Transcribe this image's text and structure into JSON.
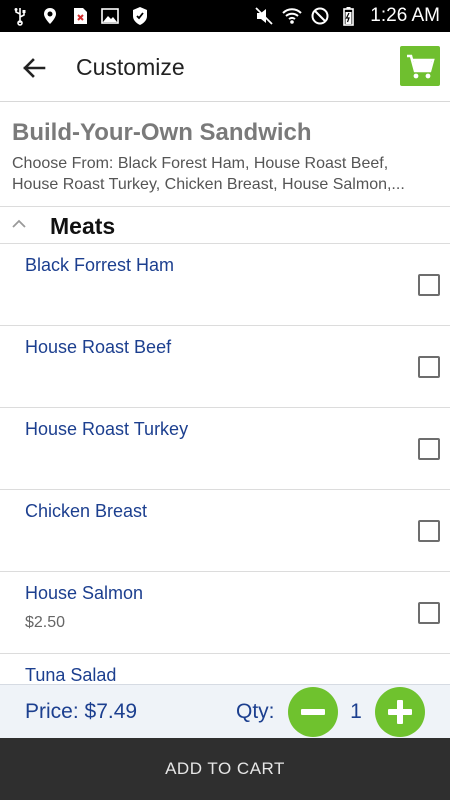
{
  "status_bar": {
    "time": "1:26 AM",
    "left_icons": [
      "usb-icon",
      "location-icon",
      "file-error-icon",
      "image-icon",
      "shield-icon"
    ],
    "right_icons": [
      "mute-icon",
      "wifi-icon",
      "block-icon",
      "battery-icon"
    ]
  },
  "app_bar": {
    "title": "Customize",
    "back_icon": "arrow-left-icon",
    "cart_icon": "cart-icon"
  },
  "item": {
    "title": "Build-Your-Own Sandwich",
    "description_line1": "Choose From: Black Forest Ham, House Roast Beef,",
    "description_line2": "House Roast Turkey, Chicken Breast, House Salmon,..."
  },
  "section": {
    "title": "Meats",
    "collapse_icon": "chevron-up-icon"
  },
  "options": [
    {
      "name": "Black Forrest Ham",
      "price": "",
      "checked": false
    },
    {
      "name": "House Roast Beef",
      "price": "",
      "checked": false
    },
    {
      "name": "House Roast Turkey",
      "price": "",
      "checked": false
    },
    {
      "name": "Chicken Breast",
      "price": "",
      "checked": false
    },
    {
      "name": "House Salmon",
      "price": "$2.50",
      "checked": false
    },
    {
      "name": "Tuna Salad",
      "price": "",
      "checked": false
    }
  ],
  "footer": {
    "price_label": "Price: $7.49",
    "qty_label": "Qty:",
    "qty_value": "1",
    "add_to_cart": "ADD TO CART"
  },
  "colors": {
    "accent_green": "#6fc22e",
    "link_blue": "#1c3f8f",
    "dark_bar": "#2f2f2f"
  }
}
